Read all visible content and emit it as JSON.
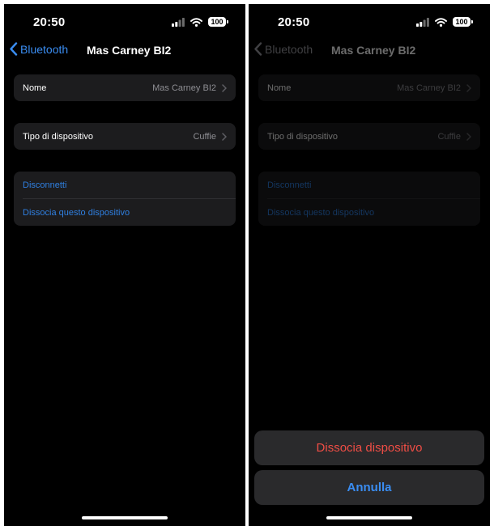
{
  "left_screen": {
    "status": {
      "time": "20:50",
      "battery": "100"
    },
    "nav": {
      "back_label": "Bluetooth",
      "title": "Mas Carney BI2"
    },
    "name_row": {
      "label": "Nome",
      "value": "Mas Carney BI2"
    },
    "type_row": {
      "label": "Tipo di dispositivo",
      "value": "Cuffie"
    },
    "actions": {
      "disconnect": "Disconnetti",
      "forget": "Dissocia questo dispositivo"
    }
  },
  "right_screen": {
    "status": {
      "time": "20:50",
      "battery": "100"
    },
    "nav": {
      "back_label": "Bluetooth",
      "title": "Mas Carney BI2"
    },
    "name_row": {
      "label": "Nome",
      "value": "Mas Carney BI2"
    },
    "type_row": {
      "label": "Tipo di dispositivo",
      "value": "Cuffie"
    },
    "actions": {
      "disconnect": "Disconnetti",
      "forget": "Dissocia questo dispositivo"
    },
    "action_sheet": {
      "destructive_label": "Dissocia dispositivo",
      "cancel_label": "Annulla"
    }
  },
  "colors": {
    "accent": "#3a8df2",
    "link": "#2f7fe0",
    "destructive": "#ef4d45",
    "cell_background": "#1c1c1e",
    "secondary_text": "#8e8e93"
  },
  "icons": [
    "cellular-signal-icon",
    "wifi-icon",
    "battery-icon",
    "chevron-left-icon",
    "chevron-right-icon"
  ]
}
